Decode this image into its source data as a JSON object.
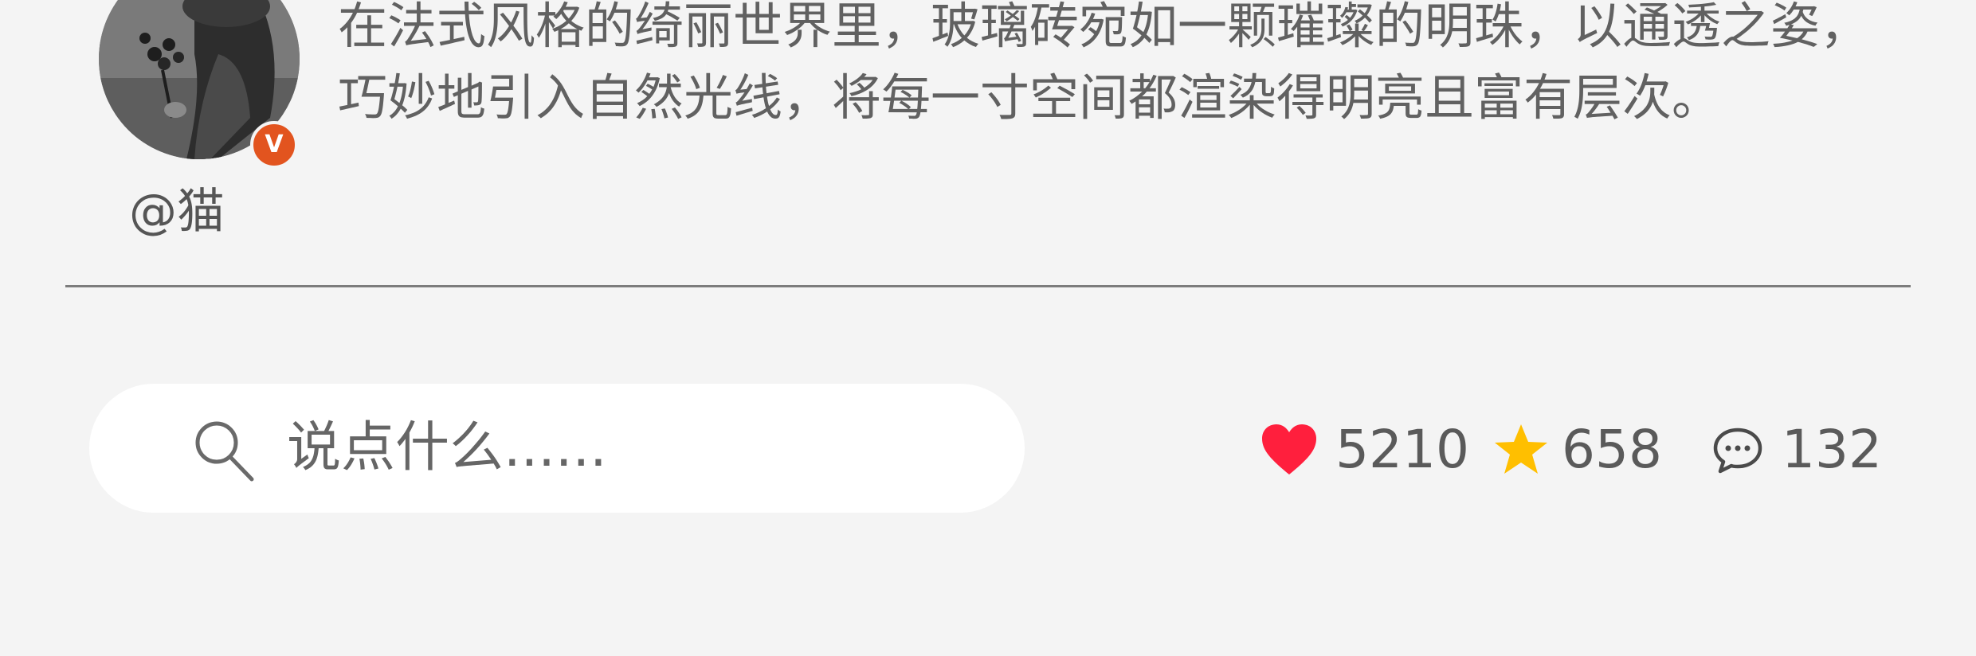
{
  "post": {
    "author": {
      "handle": "@猫",
      "verified_badge": "V",
      "avatar": "profile-photo"
    },
    "text": "在法式风格的绮丽世界里，玻璃砖宛如一颗璀璨的明珠，以通透之姿，巧妙地引入自然光线，将每一寸空间都渲染得明亮且富有层次。"
  },
  "comment_bar": {
    "placeholder": "说点什么......",
    "icon": "search-icon"
  },
  "stats": {
    "likes": "5210",
    "favorites": "658",
    "comments": "132"
  },
  "colors": {
    "background": "#f4f4f4",
    "like_heart": "#ff1f3d",
    "favorite_star": "#ffbf00",
    "verified_badge": "#e2541f"
  }
}
